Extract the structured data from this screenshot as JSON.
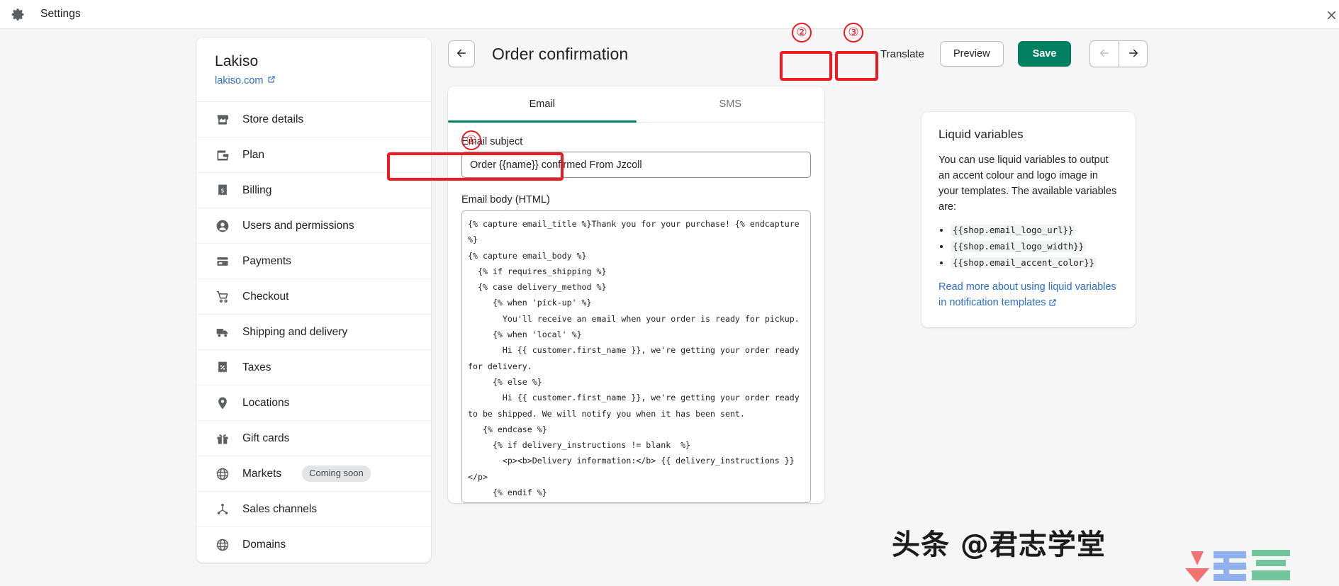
{
  "window": {
    "title": "Settings",
    "gear_icon": "gear-icon",
    "close_icon": "close-icon"
  },
  "sidebar": {
    "shop_name": "Lakiso",
    "shop_url": "lakiso.com",
    "items": [
      {
        "label": "Store details",
        "icon": "store-icon",
        "badge": ""
      },
      {
        "label": "Plan",
        "icon": "wallet-icon",
        "badge": ""
      },
      {
        "label": "Billing",
        "icon": "receipt-dollar-icon",
        "badge": ""
      },
      {
        "label": "Users and permissions",
        "icon": "user-circle-icon",
        "badge": ""
      },
      {
        "label": "Payments",
        "icon": "credit-card-icon",
        "badge": ""
      },
      {
        "label": "Checkout",
        "icon": "cart-icon",
        "badge": ""
      },
      {
        "label": "Shipping and delivery",
        "icon": "truck-icon",
        "badge": ""
      },
      {
        "label": "Taxes",
        "icon": "receipt-percent-icon",
        "badge": ""
      },
      {
        "label": "Locations",
        "icon": "map-pin-icon",
        "badge": ""
      },
      {
        "label": "Gift cards",
        "icon": "gift-icon",
        "badge": ""
      },
      {
        "label": "Markets",
        "icon": "globe-icon",
        "badge": "Coming soon"
      },
      {
        "label": "Sales channels",
        "icon": "share-nodes-icon",
        "badge": ""
      },
      {
        "label": "Domains",
        "icon": "globe-icon",
        "badge": ""
      }
    ]
  },
  "header": {
    "back_icon": "arrow-left-icon",
    "title": "Order confirmation",
    "translate_label": "Translate",
    "preview_label": "Preview",
    "save_label": "Save",
    "prev_icon": "arrow-left-icon",
    "next_icon": "arrow-right-icon"
  },
  "annotations": [
    {
      "number": "①",
      "target": "email-subject-input"
    },
    {
      "number": "②",
      "target": "preview-button"
    },
    {
      "number": "③",
      "target": "save-button"
    }
  ],
  "editor": {
    "tabs": [
      {
        "label": "Email",
        "active": true
      },
      {
        "label": "SMS",
        "active": false
      }
    ],
    "subject_label": "Email subject",
    "subject_value": "Order {{name}} confirmed From Jzcoll",
    "subject_placeholder": "Email subject",
    "body_label": "Email body (HTML)",
    "body_value": "{% capture email_title %}Thank you for your purchase! {% endcapture %}\n{% capture email_body %}\n  {% if requires_shipping %}\n  {% case delivery_method %}\n     {% when 'pick-up' %}\n       You'll receive an email when your order is ready for pickup.\n     {% when 'local' %}\n       Hi {{ customer.first_name }}, we're getting your order ready for delivery.\n     {% else %}\n       Hi {{ customer.first_name }}, we're getting your order ready to be shipped. We will notify you when it has been sent.\n   {% endcase %}\n     {% if delivery_instructions != blank  %}\n       <p><b>Delivery information:</b> {{ delivery_instructions }}</p>\n     {% endif %}\n  {% endif %}\n{% endcapture %}"
  },
  "liquid_panel": {
    "title": "Liquid variables",
    "paragraph": "You can use liquid variables to output an accent colour and logo image in your templates. The available variables are:",
    "variables": [
      "{{shop.email_logo_url}}",
      "{{shop.email_logo_width}}",
      "{{shop.email_accent_color}}"
    ],
    "link_text": "Read more about using liquid variables in notification templates",
    "link_icon": "external-link-icon"
  },
  "watermark": {
    "text": "头条 @君志学堂"
  },
  "colors": {
    "accent_green": "#008060",
    "link_blue": "#2c6ecb",
    "annotation_red": "#ec1c24",
    "page_bg": "#f6f6f7",
    "text": "#202223"
  }
}
